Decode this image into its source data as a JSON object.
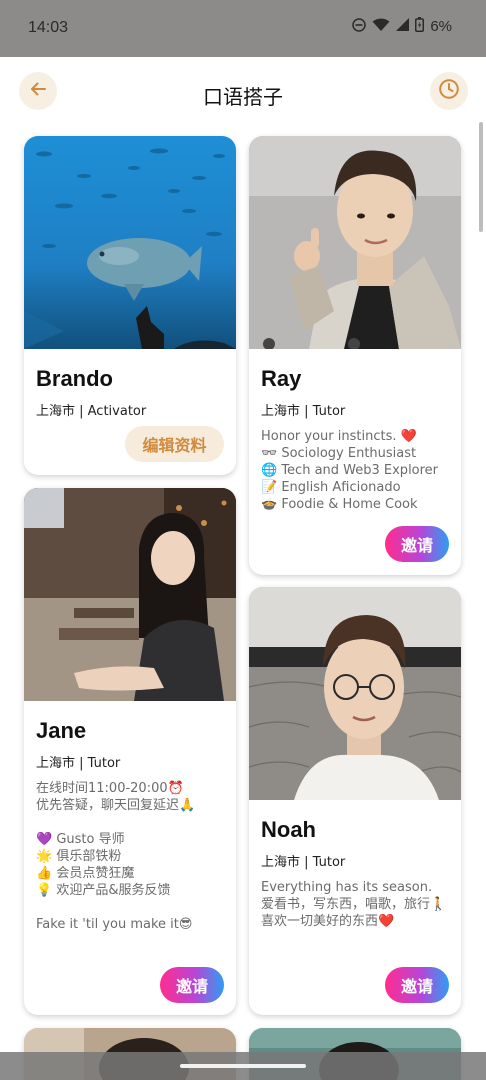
{
  "status": {
    "time": "14:03",
    "battery": "6%"
  },
  "header": {
    "title": "口语搭子",
    "back_icon": "arrow-left-icon",
    "history_icon": "clock-icon"
  },
  "cards": {
    "brando": {
      "name": "Brando",
      "meta": "上海市 | Activator",
      "action": "编辑资料"
    },
    "ray": {
      "name": "Ray",
      "meta": "上海市 | Tutor",
      "bio": [
        "Honor your instincts. ❤️",
        "👓 Sociology Enthusiast",
        "🌐 Tech and Web3 Explorer",
        "📝 English Aficionado",
        "🍲 Foodie & Home Cook"
      ],
      "action": "邀请"
    },
    "jane": {
      "name": "Jane",
      "meta": "上海市 | Tutor",
      "bio": [
        "在线时间11:00-20:00⏰",
        "优先答疑，聊天回复延迟🙏",
        "💜 Gusto 导师",
        "🌟 俱乐部铁粉",
        "👍 会员点赞狂魔",
        "💡 欢迎产品&服务反馈",
        "Fake it 'til you make it😎"
      ],
      "action": "邀请"
    },
    "noah": {
      "name": "Noah",
      "meta": "上海市 | Tutor",
      "bio": [
        "Everything has its season.",
        "爱看书，写东西，唱歌，旅行🚶",
        "喜欢一切美好的东西❤️"
      ],
      "action": "邀请"
    }
  },
  "colors": {
    "accent": "#d08b3f",
    "accent_bg": "#f7efe2",
    "invite_gradient": [
      "#ff2d8f",
      "#b845d6",
      "#2f9df3"
    ]
  }
}
